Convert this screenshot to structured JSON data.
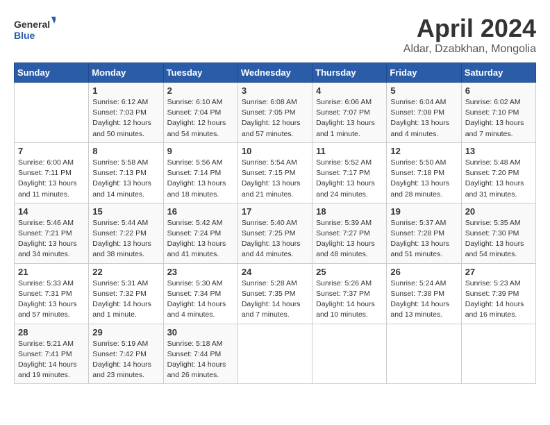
{
  "header": {
    "logo_general": "General",
    "logo_blue": "Blue",
    "month_title": "April 2024",
    "location": "Aldar, Dzabkhan, Mongolia"
  },
  "days_of_week": [
    "Sunday",
    "Monday",
    "Tuesday",
    "Wednesday",
    "Thursday",
    "Friday",
    "Saturday"
  ],
  "weeks": [
    [
      {
        "day": "",
        "info": ""
      },
      {
        "day": "1",
        "info": "Sunrise: 6:12 AM\nSunset: 7:03 PM\nDaylight: 12 hours\nand 50 minutes."
      },
      {
        "day": "2",
        "info": "Sunrise: 6:10 AM\nSunset: 7:04 PM\nDaylight: 12 hours\nand 54 minutes."
      },
      {
        "day": "3",
        "info": "Sunrise: 6:08 AM\nSunset: 7:05 PM\nDaylight: 12 hours\nand 57 minutes."
      },
      {
        "day": "4",
        "info": "Sunrise: 6:06 AM\nSunset: 7:07 PM\nDaylight: 13 hours\nand 1 minute."
      },
      {
        "day": "5",
        "info": "Sunrise: 6:04 AM\nSunset: 7:08 PM\nDaylight: 13 hours\nand 4 minutes."
      },
      {
        "day": "6",
        "info": "Sunrise: 6:02 AM\nSunset: 7:10 PM\nDaylight: 13 hours\nand 7 minutes."
      }
    ],
    [
      {
        "day": "7",
        "info": "Sunrise: 6:00 AM\nSunset: 7:11 PM\nDaylight: 13 hours\nand 11 minutes."
      },
      {
        "day": "8",
        "info": "Sunrise: 5:58 AM\nSunset: 7:13 PM\nDaylight: 13 hours\nand 14 minutes."
      },
      {
        "day": "9",
        "info": "Sunrise: 5:56 AM\nSunset: 7:14 PM\nDaylight: 13 hours\nand 18 minutes."
      },
      {
        "day": "10",
        "info": "Sunrise: 5:54 AM\nSunset: 7:15 PM\nDaylight: 13 hours\nand 21 minutes."
      },
      {
        "day": "11",
        "info": "Sunrise: 5:52 AM\nSunset: 7:17 PM\nDaylight: 13 hours\nand 24 minutes."
      },
      {
        "day": "12",
        "info": "Sunrise: 5:50 AM\nSunset: 7:18 PM\nDaylight: 13 hours\nand 28 minutes."
      },
      {
        "day": "13",
        "info": "Sunrise: 5:48 AM\nSunset: 7:20 PM\nDaylight: 13 hours\nand 31 minutes."
      }
    ],
    [
      {
        "day": "14",
        "info": "Sunrise: 5:46 AM\nSunset: 7:21 PM\nDaylight: 13 hours\nand 34 minutes."
      },
      {
        "day": "15",
        "info": "Sunrise: 5:44 AM\nSunset: 7:22 PM\nDaylight: 13 hours\nand 38 minutes."
      },
      {
        "day": "16",
        "info": "Sunrise: 5:42 AM\nSunset: 7:24 PM\nDaylight: 13 hours\nand 41 minutes."
      },
      {
        "day": "17",
        "info": "Sunrise: 5:40 AM\nSunset: 7:25 PM\nDaylight: 13 hours\nand 44 minutes."
      },
      {
        "day": "18",
        "info": "Sunrise: 5:39 AM\nSunset: 7:27 PM\nDaylight: 13 hours\nand 48 minutes."
      },
      {
        "day": "19",
        "info": "Sunrise: 5:37 AM\nSunset: 7:28 PM\nDaylight: 13 hours\nand 51 minutes."
      },
      {
        "day": "20",
        "info": "Sunrise: 5:35 AM\nSunset: 7:30 PM\nDaylight: 13 hours\nand 54 minutes."
      }
    ],
    [
      {
        "day": "21",
        "info": "Sunrise: 5:33 AM\nSunset: 7:31 PM\nDaylight: 13 hours\nand 57 minutes."
      },
      {
        "day": "22",
        "info": "Sunrise: 5:31 AM\nSunset: 7:32 PM\nDaylight: 14 hours\nand 1 minute."
      },
      {
        "day": "23",
        "info": "Sunrise: 5:30 AM\nSunset: 7:34 PM\nDaylight: 14 hours\nand 4 minutes."
      },
      {
        "day": "24",
        "info": "Sunrise: 5:28 AM\nSunset: 7:35 PM\nDaylight: 14 hours\nand 7 minutes."
      },
      {
        "day": "25",
        "info": "Sunrise: 5:26 AM\nSunset: 7:37 PM\nDaylight: 14 hours\nand 10 minutes."
      },
      {
        "day": "26",
        "info": "Sunrise: 5:24 AM\nSunset: 7:38 PM\nDaylight: 14 hours\nand 13 minutes."
      },
      {
        "day": "27",
        "info": "Sunrise: 5:23 AM\nSunset: 7:39 PM\nDaylight: 14 hours\nand 16 minutes."
      }
    ],
    [
      {
        "day": "28",
        "info": "Sunrise: 5:21 AM\nSunset: 7:41 PM\nDaylight: 14 hours\nand 19 minutes."
      },
      {
        "day": "29",
        "info": "Sunrise: 5:19 AM\nSunset: 7:42 PM\nDaylight: 14 hours\nand 23 minutes."
      },
      {
        "day": "30",
        "info": "Sunrise: 5:18 AM\nSunset: 7:44 PM\nDaylight: 14 hours\nand 26 minutes."
      },
      {
        "day": "",
        "info": ""
      },
      {
        "day": "",
        "info": ""
      },
      {
        "day": "",
        "info": ""
      },
      {
        "day": "",
        "info": ""
      }
    ]
  ]
}
